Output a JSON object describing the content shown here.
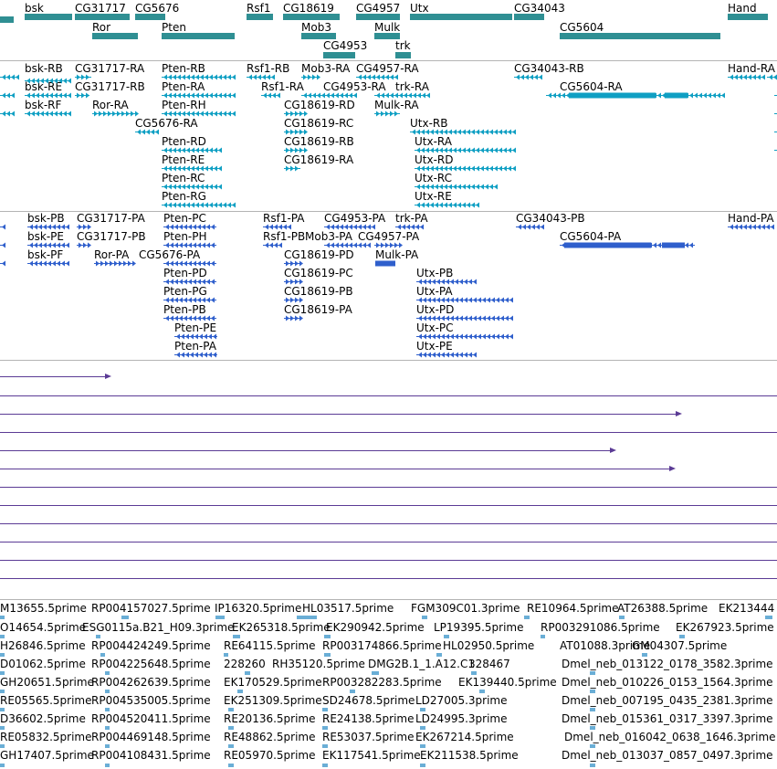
{
  "colors": {
    "gene": "#2f8f93",
    "transcript": "#0f9fc3",
    "protein": "#2f5fcc",
    "long_read": "#5b3b95",
    "est": "#6aaed6",
    "divider": "#b4b4b4"
  },
  "gene_track": {
    "labels": [
      "bsk",
      "CG31717",
      "CG5676",
      "Rsf1",
      "CG18619",
      "CG4957",
      "Utx",
      "CG34043",
      "Hand",
      "Ror",
      "Pten",
      "Mob3",
      "Mulk",
      "CG5604",
      "CG4953",
      "trk"
    ]
  },
  "transcript_track": {
    "labels": [
      "bsk-RB",
      "CG31717-RA",
      "Pten-RB",
      "Rsf1-RB",
      "Mob3-RA",
      "CG4957-RA",
      "CG34043-RB",
      "Hand-RA",
      "bsk-RE",
      "CG31717-RB",
      "Pten-RA",
      "Rsf1-RA",
      "CG4953-RA",
      "trk-RA",
      "CG5604-RA",
      "bsk-RF",
      "Ror-RA",
      "Pten-RH",
      "CG18619-RD",
      "Mulk-RA",
      "CG5676-RA",
      "CG18619-RC",
      "Utx-RB",
      "Pten-RD",
      "CG18619-RB",
      "Utx-RA",
      "Pten-RE",
      "CG18619-RA",
      "Utx-RD",
      "Pten-RC",
      "Utx-RC",
      "Pten-RG",
      "Utx-RE"
    ]
  },
  "protein_track": {
    "labels": [
      "bsk-PB",
      "CG31717-PA",
      "Pten-PC",
      "Rsf1-PA",
      "CG4953-PA",
      "trk-PA",
      "CG34043-PB",
      "Hand-PA",
      "bsk-PE",
      "CG31717-PB",
      "Pten-PH",
      "Rsf1-PB",
      "Mob3-PA",
      "CG4957-PA",
      "CG5604-PA",
      "bsk-PF",
      "Ror-PA",
      "CG5676-PA",
      "CG18619-PD",
      "Mulk-PA",
      "Pten-PD",
      "CG18619-PC",
      "Utx-PB",
      "Pten-PG",
      "CG18619-PB",
      "Utx-PA",
      "Pten-PB",
      "CG18619-PA",
      "Utx-PD",
      "Pten-PE",
      "Utx-PC",
      "Pten-PA",
      "Utx-PE"
    ]
  },
  "est_track": {
    "labels": [
      "M13655.5prime",
      "RP004157027.5prime",
      "IP16320.5prime",
      "HL03517.5prime",
      "FGM309C01.3prime",
      "RE10964.5prime",
      "AT26388.5prime",
      "EK213444",
      "O14654.5prime",
      "ESG0115a.B21_H09.3prime",
      "EK265318.5prime",
      "EK290942.5prime",
      "LP19395.5prime",
      "RP003291086.5prime",
      "EK267923.5prime",
      "H26846.5prime",
      "RP004424249.5prime",
      "RE64115.5prime",
      "RP003174866.5prime",
      "HL02950.5prime",
      "AT01088.3prime",
      "GM04307.5prime",
      "D01062.5prime",
      "RP004225648.5prime",
      "228260",
      "RH35120.5prime",
      "DMG2B.1_1.A12.C1",
      "328467",
      "Dmel_neb_013122_0178_3582.3prime",
      "GH20651.5prime",
      "RP004262639.5prime",
      "EK170529.5prime",
      "RP003282283.5prime",
      "EK139440.5prime",
      "Dmel_neb_010226_0153_1564.3prime",
      "RE05565.5prime",
      "RP004535005.5prime",
      "EK251309.5prime",
      "SD24678.5prime",
      "LD27005.3prime",
      "Dmel_neb_007195_0435_2381.3prime",
      "D36602.5prime",
      "RP004520411.5prime",
      "RE20136.5prime",
      "RE24138.5prime",
      "LD24995.3prime",
      "Dmel_neb_015361_0317_3397.3prime",
      "RE05832.5prime",
      "RP004469148.5prime",
      "RE48862.5prime",
      "RE53037.5prime",
      "EK267214.5prime",
      "Dmel_neb_016042_0638_1646.3prime",
      "GH17407.5prime",
      "RP004108431.5prime",
      "RE05970.5prime",
      "EK117541.5prime",
      "EK211538.5prime",
      "Dmel_neb_013037_0857_0497.3prime"
    ]
  }
}
